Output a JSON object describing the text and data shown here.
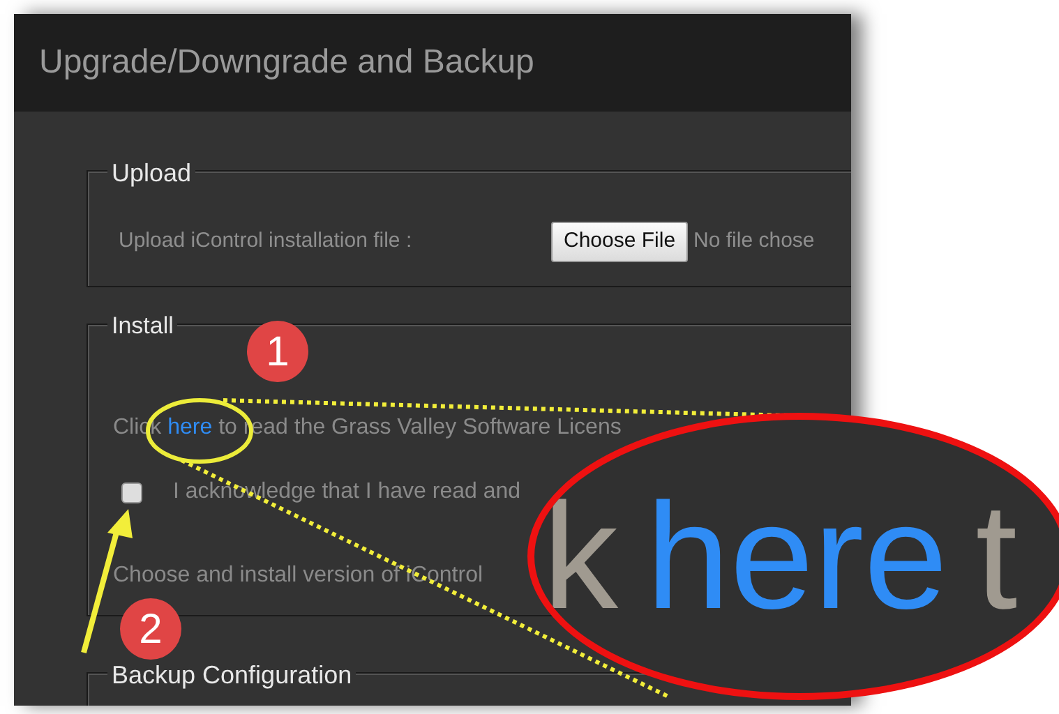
{
  "window": {
    "title": "Upgrade/Downgrade and Backup"
  },
  "upload": {
    "legend": "Upload",
    "label": "Upload iControl installation file :",
    "button": "Choose File",
    "file_status": "No file chose"
  },
  "install": {
    "legend": "Install",
    "license_before": "Click",
    "license_link": "here",
    "license_after": "to read the Grass Valley Software Licens",
    "acknowledge": {
      "label": "I acknowledge that I have read and",
      "checked": false
    },
    "choose_text": "Choose and install version of iControl"
  },
  "backup": {
    "legend": "Backup Configuration"
  },
  "callouts": [
    {
      "number": "1"
    },
    {
      "number": "2"
    }
  ],
  "magnifier": {
    "before": "k",
    "link": "here",
    "after": "t"
  }
}
